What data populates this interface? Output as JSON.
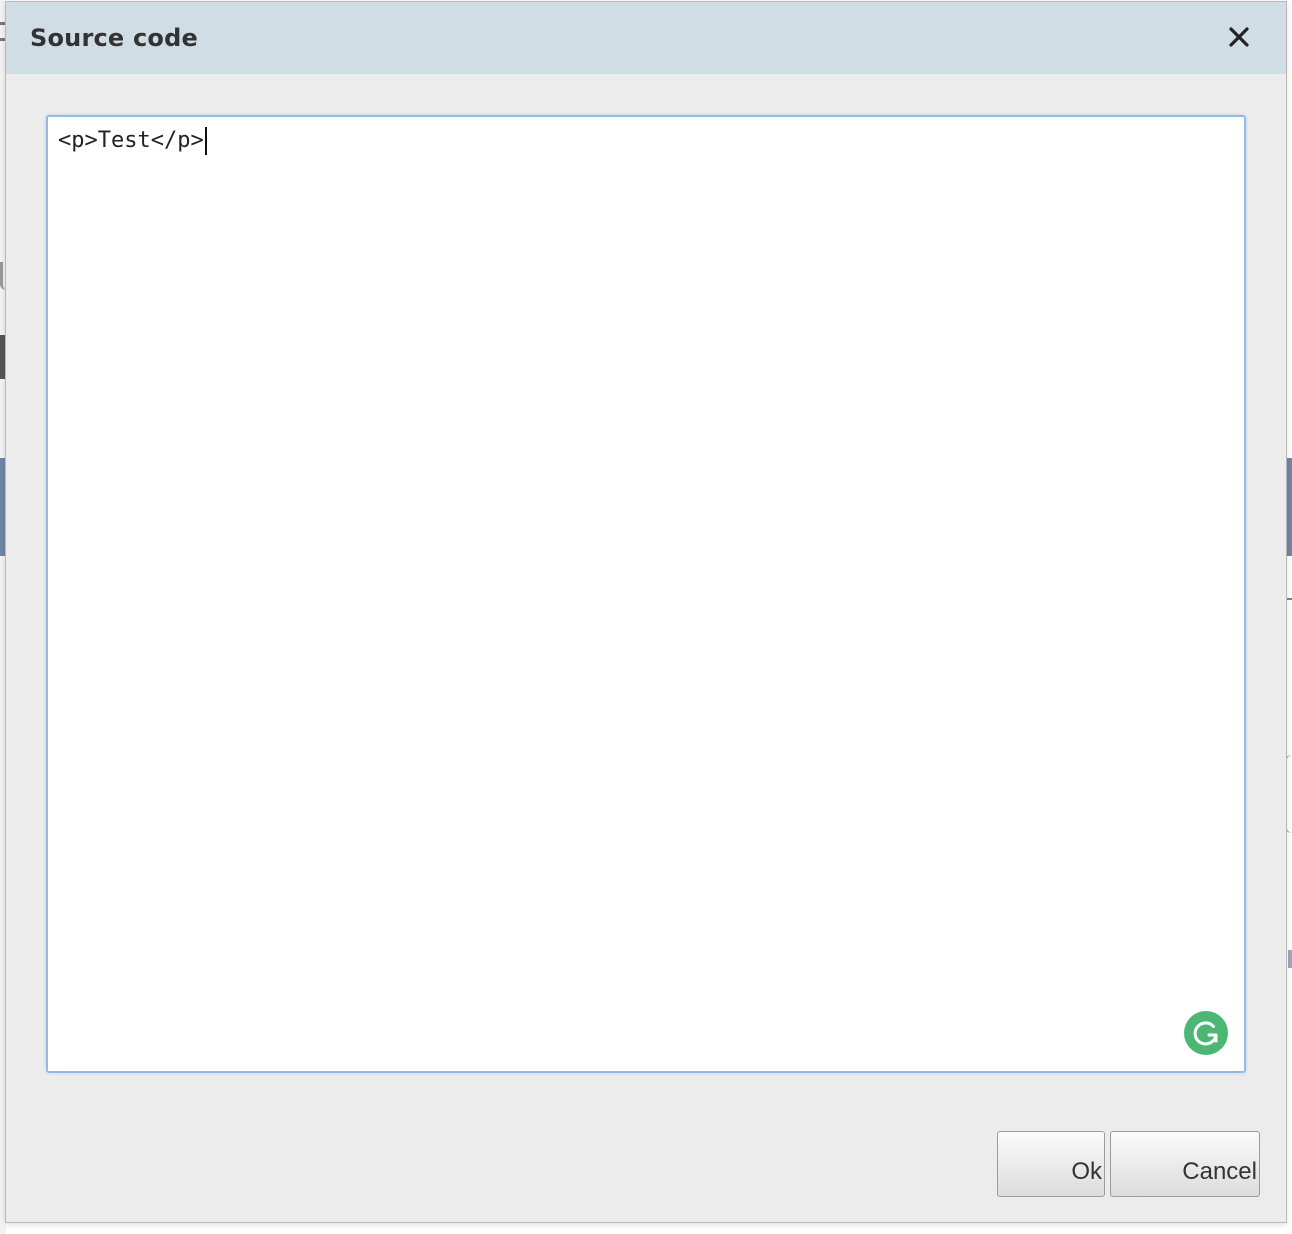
{
  "dialog": {
    "title": "Source code",
    "close_icon": "close-icon"
  },
  "editor": {
    "content": "<p>Test</p>",
    "grammarly_icon": "grammarly-icon",
    "grammarly_color": "#4cb774",
    "focus_border_color": "#8fbbe6"
  },
  "buttons": {
    "ok_label": "Ok",
    "cancel_label": "Cancel"
  },
  "colors": {
    "header_background": "#d0dde4",
    "dialog_background": "#ececec"
  }
}
